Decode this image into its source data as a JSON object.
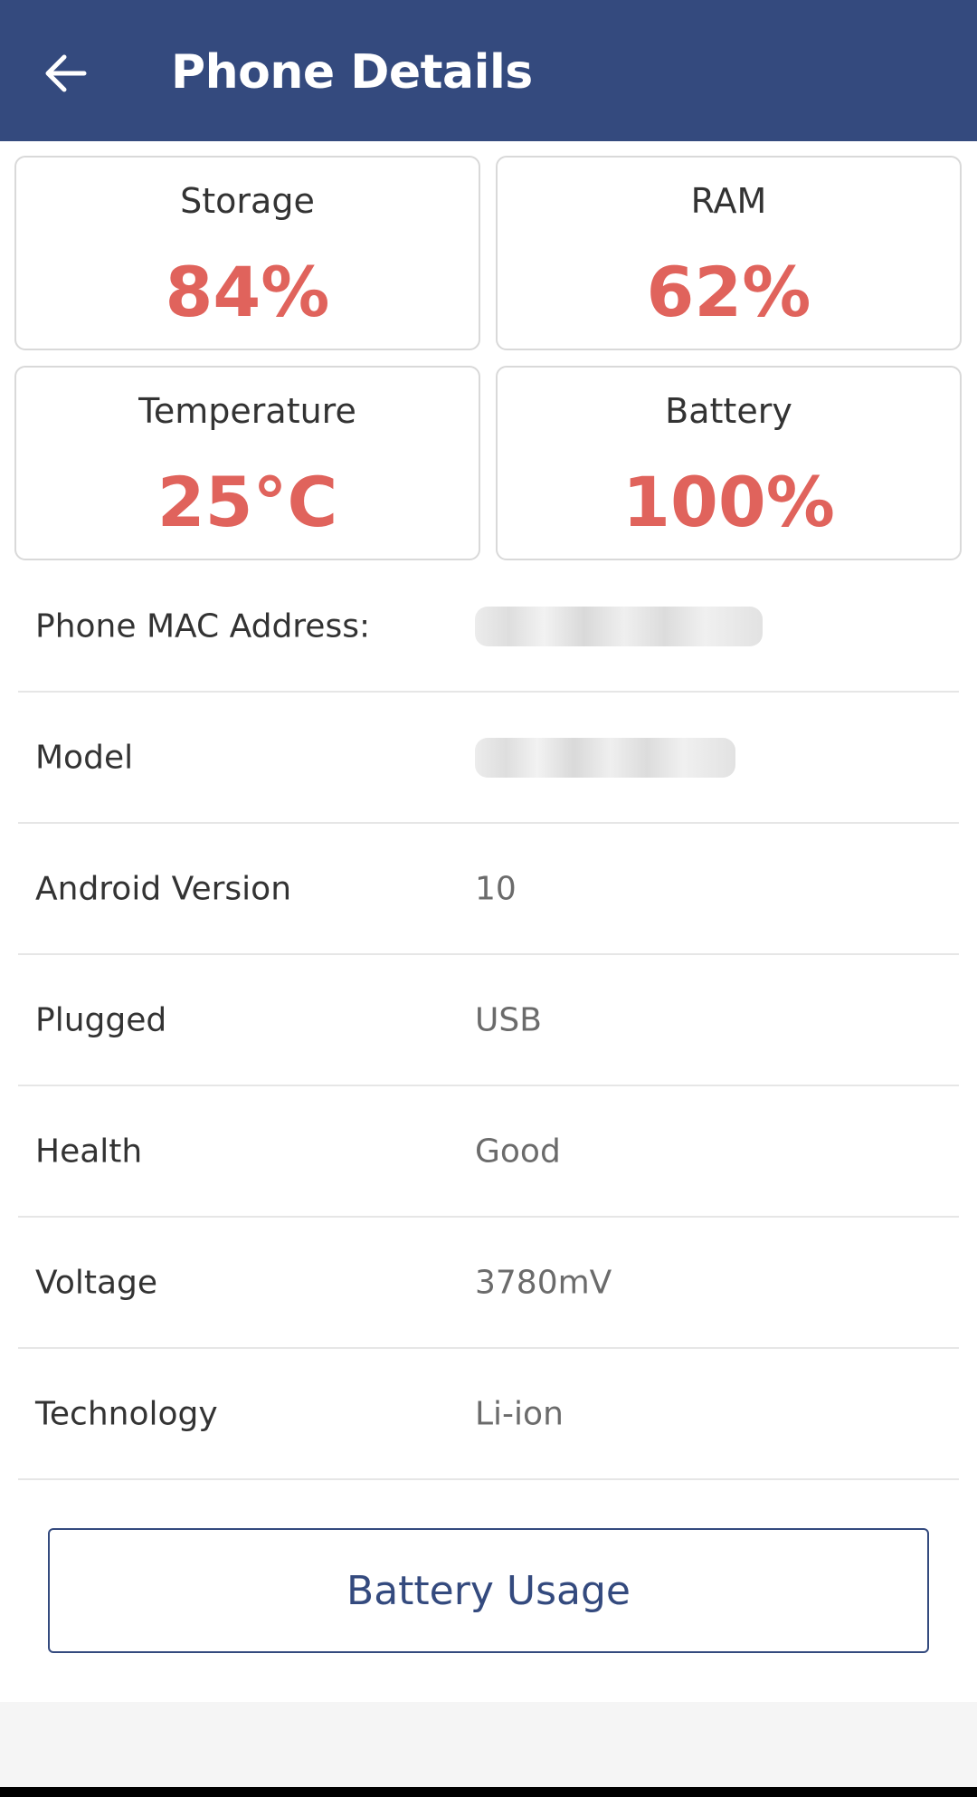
{
  "header": {
    "title": "Phone Details",
    "back_icon": "arrow-left-icon",
    "color": "#344a7e"
  },
  "cards": [
    {
      "label": "Storage",
      "value": "84%"
    },
    {
      "label": "RAM",
      "value": "62%"
    },
    {
      "label": "Temperature",
      "value": "25°C"
    },
    {
      "label": "Battery",
      "value": "100%"
    }
  ],
  "details": [
    {
      "label": "Phone MAC Address:",
      "value": null,
      "redacted": true
    },
    {
      "label": "Model",
      "value": null,
      "redacted": true
    },
    {
      "label": "Android Version",
      "value": "10"
    },
    {
      "label": "Plugged",
      "value": "USB"
    },
    {
      "label": "Health",
      "value": "Good"
    },
    {
      "label": "Voltage",
      "value": "3780mV"
    },
    {
      "label": "Technology",
      "value": "Li-ion"
    }
  ],
  "actions": {
    "battery_usage_label": "Battery Usage"
  },
  "colors": {
    "accent": "#344a7e",
    "metric": "#e0635c"
  }
}
